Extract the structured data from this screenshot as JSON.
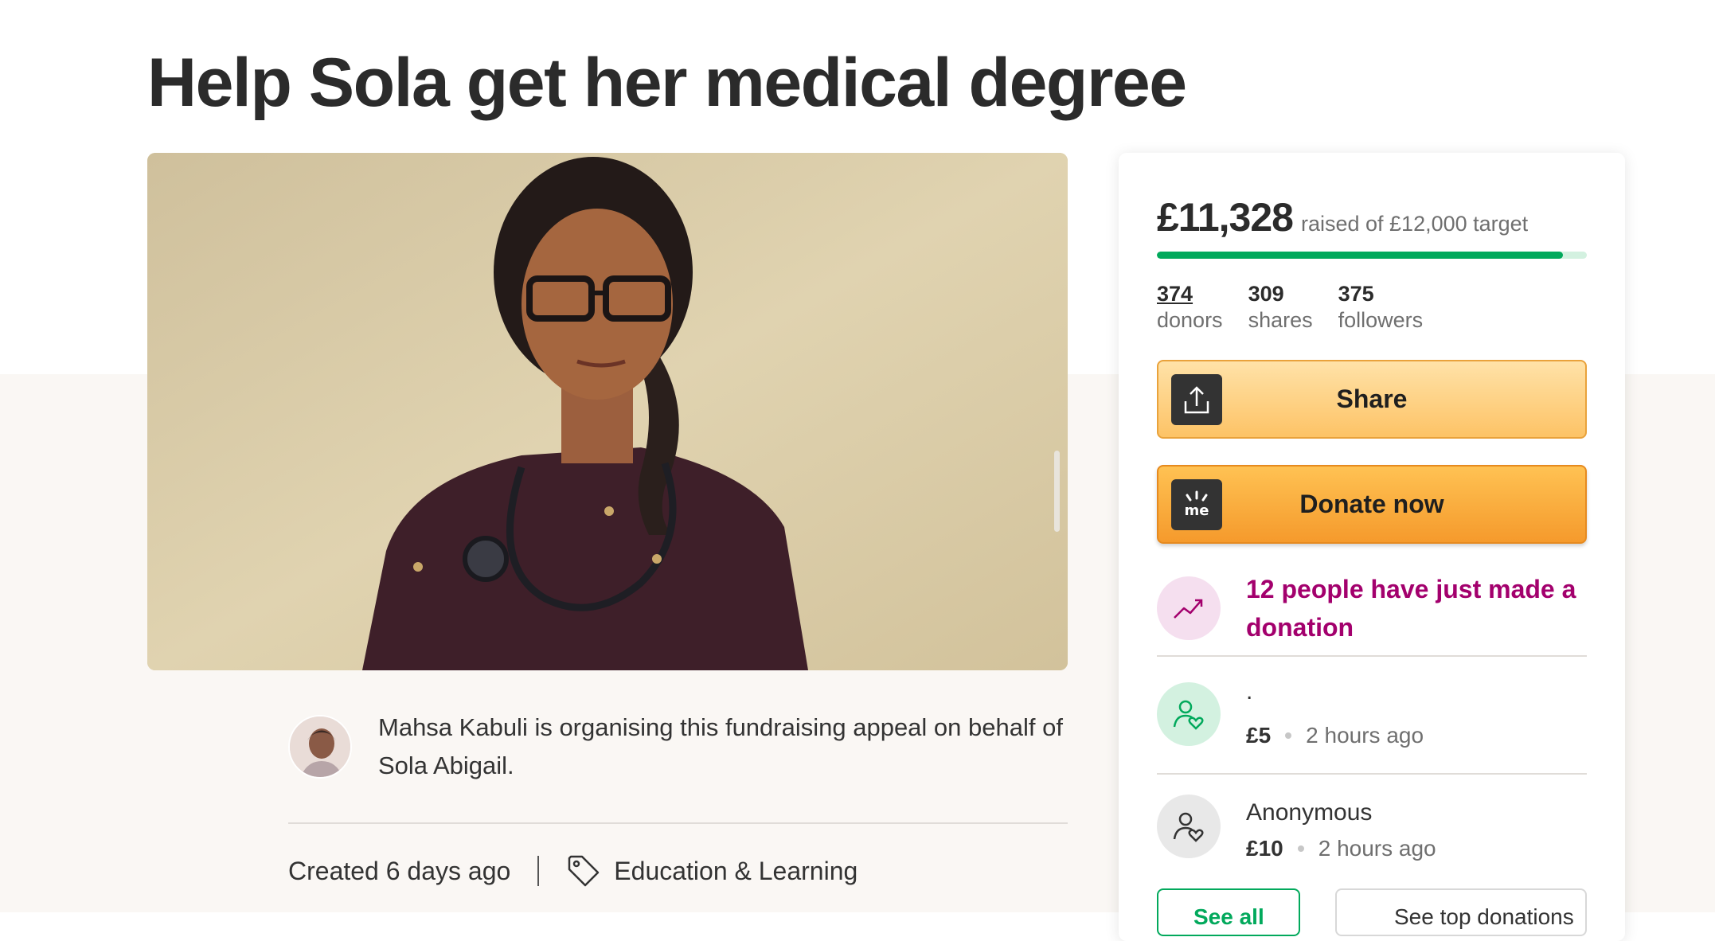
{
  "page": {
    "title": "Help Sola get her medical degree"
  },
  "organiser": {
    "text": "Mahsa Kabuli is organising this fundraising appeal on behalf of Sola Abigail."
  },
  "meta": {
    "created": "Created 6 days ago",
    "category": "Education & Learning"
  },
  "fundraising": {
    "raised": "£11,328",
    "target_text": "raised of £12,000 target",
    "progress_fraction": 0.944
  },
  "stats": [
    {
      "value": "374",
      "label": "donors"
    },
    {
      "value": "309",
      "label": "shares"
    },
    {
      "value": "375",
      "label": "followers"
    }
  ],
  "buttons": {
    "share": "Share",
    "donate": "Donate now",
    "see_all": "See all",
    "see_top": "See top donations"
  },
  "activity": {
    "trend_text": "12 people have just made a donation"
  },
  "donations": [
    {
      "name": ".",
      "amount": "£5",
      "time": "2 hours ago"
    },
    {
      "name": "Anonymous",
      "amount": "£10",
      "time": "2 hours ago"
    }
  ],
  "colors": {
    "accent_green": "#02a95c",
    "trend_purple": "#a3006d",
    "donate_orange": "#f59a2c",
    "share_yellow": "#fdc366"
  },
  "icons": [
    "upload-share-icon",
    "gofundme-logo-icon",
    "trending-up-icon",
    "person-heart-icon",
    "tag-icon"
  ]
}
